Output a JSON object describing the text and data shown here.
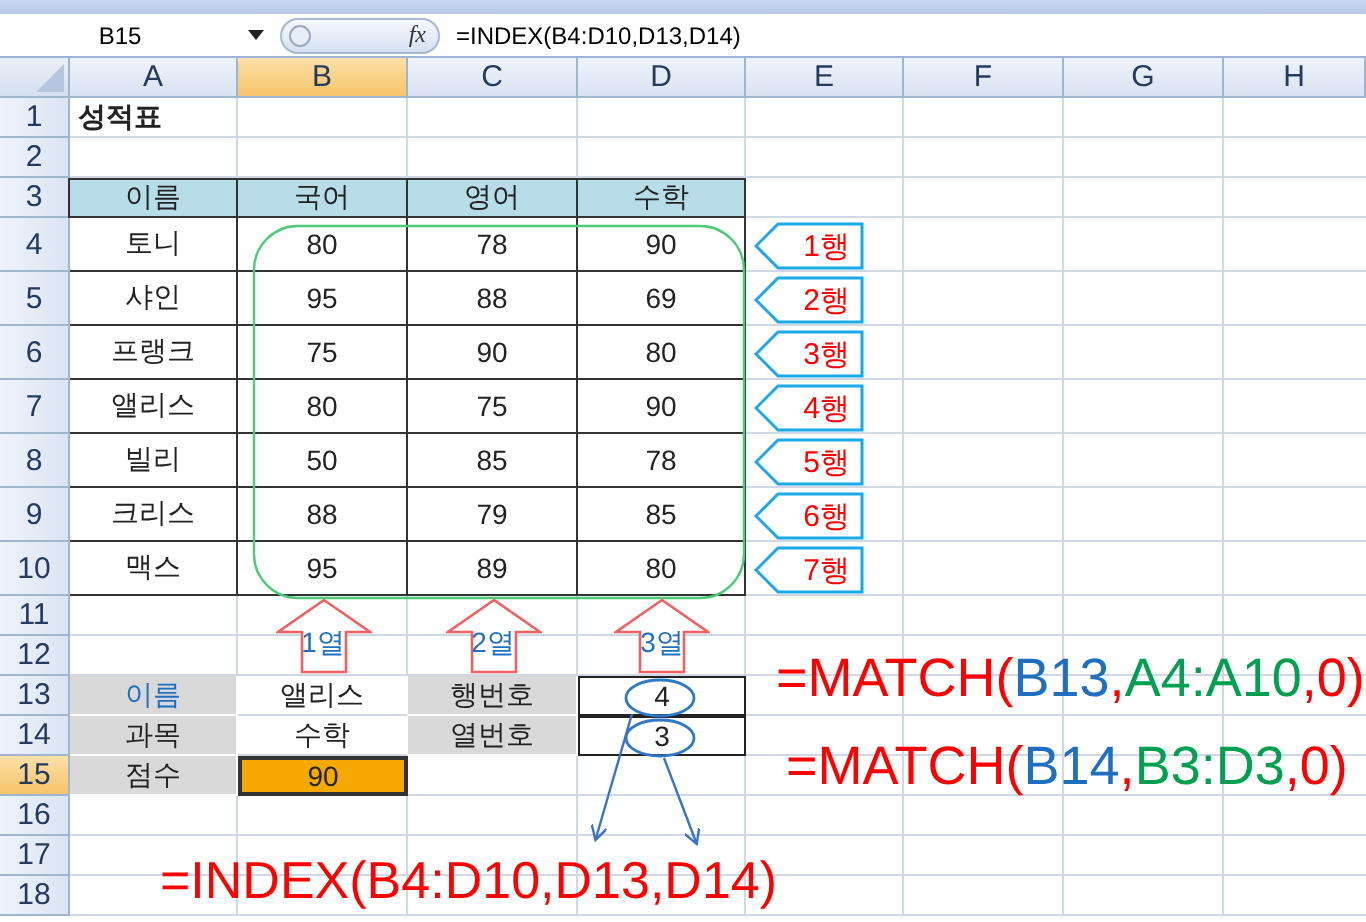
{
  "name_box": "B15",
  "function_label": "fx",
  "formula": "=INDEX(B4:D10,D13,D14)",
  "columns": [
    {
      "label": "A",
      "selected": false
    },
    {
      "label": "B",
      "selected": true
    },
    {
      "label": "C",
      "selected": false
    },
    {
      "label": "D",
      "selected": false
    },
    {
      "label": "E",
      "selected": false
    },
    {
      "label": "F",
      "selected": false
    },
    {
      "label": "G",
      "selected": false
    },
    {
      "label": "H",
      "selected": false
    }
  ],
  "rows": [
    {
      "number": "1",
      "selected": false,
      "cells": [
        {
          "text": "성적표",
          "kind": "title"
        }
      ]
    },
    {
      "number": "2",
      "selected": false
    },
    {
      "number": "3",
      "selected": false,
      "cells": [
        {
          "text": "이름",
          "kind": "header"
        },
        {
          "text": "국어",
          "kind": "header"
        },
        {
          "text": "영어",
          "kind": "header"
        },
        {
          "text": "수학",
          "kind": "header"
        }
      ]
    },
    {
      "number": "4",
      "selected": false,
      "cells": [
        {
          "text": "토니",
          "kind": "data"
        },
        {
          "text": "80",
          "kind": "data"
        },
        {
          "text": "78",
          "kind": "data"
        },
        {
          "text": "90",
          "kind": "data"
        }
      ]
    },
    {
      "number": "5",
      "selected": false,
      "cells": [
        {
          "text": "샤인",
          "kind": "data"
        },
        {
          "text": "95",
          "kind": "data"
        },
        {
          "text": "88",
          "kind": "data"
        },
        {
          "text": "69",
          "kind": "data"
        }
      ]
    },
    {
      "number": "6",
      "selected": false,
      "cells": [
        {
          "text": "프랭크",
          "kind": "data"
        },
        {
          "text": "75",
          "kind": "data"
        },
        {
          "text": "90",
          "kind": "data"
        },
        {
          "text": "80",
          "kind": "data"
        }
      ]
    },
    {
      "number": "7",
      "selected": false,
      "cells": [
        {
          "text": "앨리스",
          "kind": "data"
        },
        {
          "text": "80",
          "kind": "data"
        },
        {
          "text": "75",
          "kind": "data"
        },
        {
          "text": "90",
          "kind": "data"
        }
      ]
    },
    {
      "number": "8",
      "selected": false,
      "cells": [
        {
          "text": "빌리",
          "kind": "data"
        },
        {
          "text": "50",
          "kind": "data"
        },
        {
          "text": "85",
          "kind": "data"
        },
        {
          "text": "78",
          "kind": "data"
        }
      ]
    },
    {
      "number": "9",
      "selected": false,
      "cells": [
        {
          "text": "크리스",
          "kind": "data"
        },
        {
          "text": "88",
          "kind": "data"
        },
        {
          "text": "79",
          "kind": "data"
        },
        {
          "text": "85",
          "kind": "data"
        }
      ]
    },
    {
      "number": "10",
      "selected": false,
      "cells": [
        {
          "text": "맥스",
          "kind": "data"
        },
        {
          "text": "95",
          "kind": "data"
        },
        {
          "text": "89",
          "kind": "data"
        },
        {
          "text": "80",
          "kind": "data"
        }
      ]
    },
    {
      "number": "11",
      "selected": false
    },
    {
      "number": "12",
      "selected": false
    },
    {
      "number": "13",
      "selected": false,
      "cells": [
        {
          "text": "이름",
          "kind": "label",
          "color": "#1f6fc0"
        },
        {
          "text": "앨리스",
          "kind": "input"
        },
        {
          "text": "행번호",
          "kind": "label"
        },
        {
          "text": "4",
          "kind": "result"
        }
      ]
    },
    {
      "number": "14",
      "selected": false,
      "cells": [
        {
          "text": "과목",
          "kind": "label"
        },
        {
          "text": "수학",
          "kind": "input"
        },
        {
          "text": "열번호",
          "kind": "label"
        },
        {
          "text": "3",
          "kind": "result"
        }
      ]
    },
    {
      "number": "15",
      "selected": true,
      "cells": [
        {
          "text": "점수",
          "kind": "label"
        },
        {
          "text": "90",
          "kind": "output",
          "selected": true
        }
      ]
    },
    {
      "number": "16",
      "selected": false
    },
    {
      "number": "17",
      "selected": false
    },
    {
      "number": "18",
      "selected": false
    }
  ],
  "row_callouts": [
    "1행",
    "2행",
    "3행",
    "4행",
    "5행",
    "6행",
    "7행"
  ],
  "column_callouts": [
    "1열",
    "2열",
    "3열"
  ],
  "formulas": [
    {
      "parts": [
        {
          "text": "=MATCH(",
          "color": "#ff0000"
        },
        {
          "text": "B13",
          "color": "#1f6fc0"
        },
        {
          "text": ",",
          "color": "#ff0000"
        },
        {
          "text": "A4:A10",
          "color": "#00a050"
        },
        {
          "text": ",0)",
          "color": "#ff0000"
        }
      ]
    },
    {
      "parts": [
        {
          "text": "=MATCH(",
          "color": "#ff0000"
        },
        {
          "text": "B14",
          "color": "#1f6fc0"
        },
        {
          "text": ",",
          "color": "#ff0000"
        },
        {
          "text": "B3:D3",
          "color": "#00a050"
        },
        {
          "text": ",0)",
          "color": "#ff0000"
        }
      ]
    },
    {
      "parts": [
        {
          "text": "=INDEX(B4:D10,D13,D14)",
          "color": "#ff0000"
        }
      ]
    }
  ]
}
